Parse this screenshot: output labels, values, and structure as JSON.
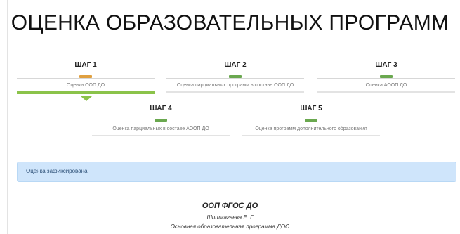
{
  "page": {
    "title": "ОЦЕНКА ОБРАЗОВАТЕЛЬНЫХ ПРОГРАММ"
  },
  "colors": {
    "active": "#8bc34a",
    "warning": "#e0a040",
    "done": "#6aa84f",
    "alert_bg": "#cfe5fb"
  },
  "steps": [
    {
      "title": "ШАГ 1",
      "description": "Оценка ООП ДО",
      "marker": "warning",
      "active": true
    },
    {
      "title": "ШАГ 2",
      "description": "Оценка парциальных программ в составе ООП ДО",
      "marker": "done",
      "active": false
    },
    {
      "title": "ШАГ 3",
      "description": "Оценка АООП ДО",
      "marker": "done",
      "active": false
    },
    {
      "title": "ШАГ 4",
      "description": "Оценка парциальных в составе АООП ДО",
      "marker": "done",
      "active": false
    },
    {
      "title": "ШАГ 5",
      "description": "Оценка программ дополнительного образования",
      "marker": "done",
      "active": false
    }
  ],
  "alert": {
    "text": "Оценка зафиксирована"
  },
  "program": {
    "title": "ООП ФГОС ДО",
    "author": "Шишмагаева Е. Г",
    "name": "Основная образовательная программа ДОО"
  }
}
